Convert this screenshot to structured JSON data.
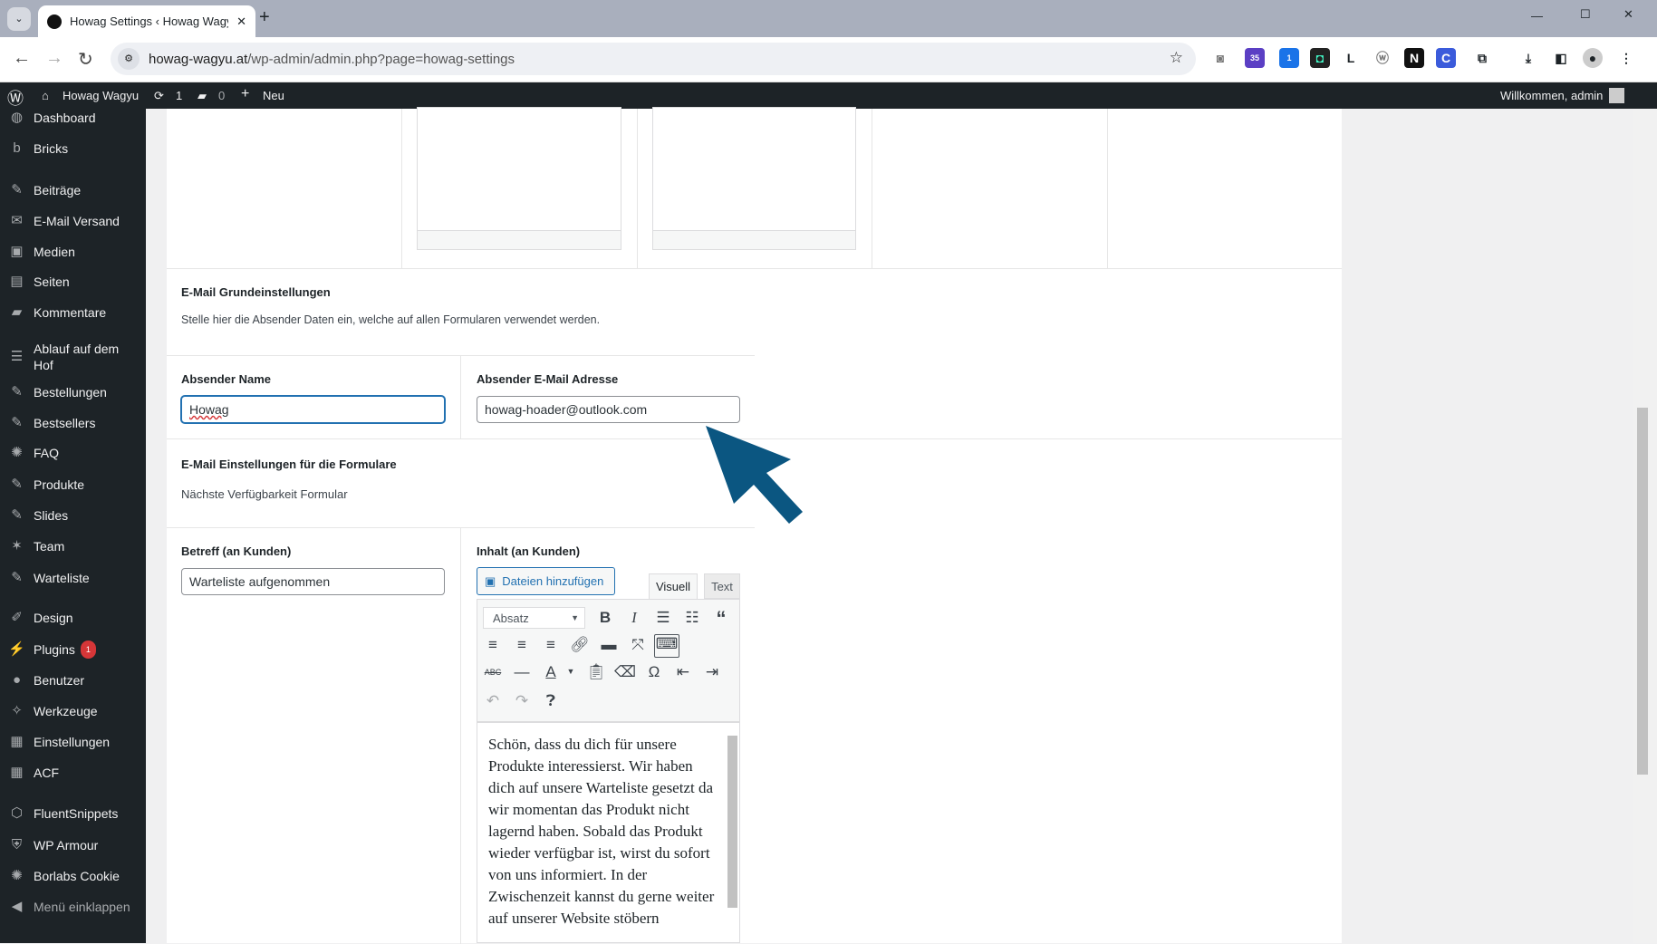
{
  "browser": {
    "tab_title": "Howag Settings ‹ Howag Wagyu",
    "url_host": "howag-wagyu.at",
    "url_path": "/wp-admin/admin.php?page=howag-settings",
    "ext_badge": "35",
    "ext_badge2": "1"
  },
  "adminbar": {
    "site": "Howag Wagyu",
    "updates": "1",
    "comments": "0",
    "new": "Neu",
    "welcome": "Willkommen, admin"
  },
  "sidebar": {
    "items": [
      {
        "label": "Dashboard",
        "icon": "◍"
      },
      {
        "label": "Bricks",
        "icon": "b"
      },
      {
        "label": "Beiträge",
        "icon": "✎"
      },
      {
        "label": "E-Mail Versand",
        "icon": "✉"
      },
      {
        "label": "Medien",
        "icon": "▣"
      },
      {
        "label": "Seiten",
        "icon": "▤"
      },
      {
        "label": "Kommentare",
        "icon": "▰"
      },
      {
        "label": "Ablauf auf dem Hof",
        "icon": "☰"
      },
      {
        "label": "Bestellungen",
        "icon": "✎"
      },
      {
        "label": "Bestsellers",
        "icon": "✎"
      },
      {
        "label": "FAQ",
        "icon": "✺"
      },
      {
        "label": "Produkte",
        "icon": "✎"
      },
      {
        "label": "Slides",
        "icon": "✎"
      },
      {
        "label": "Team",
        "icon": "✶"
      },
      {
        "label": "Warteliste",
        "icon": "✎"
      },
      {
        "label": "Design",
        "icon": "✐"
      },
      {
        "label": "Plugins",
        "icon": "⚡",
        "badge": "1"
      },
      {
        "label": "Benutzer",
        "icon": "●"
      },
      {
        "label": "Werkzeuge",
        "icon": "✧"
      },
      {
        "label": "Einstellungen",
        "icon": "▦"
      },
      {
        "label": "ACF",
        "icon": "▦"
      },
      {
        "label": "FluentSnippets",
        "icon": "⬡"
      },
      {
        "label": "WP Armour",
        "icon": "⛨"
      },
      {
        "label": "Borlabs Cookie",
        "icon": "✺"
      },
      {
        "label": "Menü einklappen",
        "icon": "◀"
      }
    ]
  },
  "section1": {
    "title": "E-Mail Grundeinstellungen",
    "desc": "Stelle hier die Absender Daten ein, welche auf allen Formularen verwendet werden."
  },
  "sender": {
    "name_label": "Absender Name",
    "name_value": "Howag",
    "email_label": "Absender E-Mail Adresse",
    "email_value": "howag-hoader@outlook.com"
  },
  "section2": {
    "title": "E-Mail Einstellungen für die Formulare",
    "subtitle": "Nächste Verfügbarkeit Formular"
  },
  "form": {
    "subject_label": "Betreff (an Kunden)",
    "subject_value": "Warteliste aufgenommen",
    "content_label": "Inhalt (an Kunden)",
    "add_media": "Dateien hinzufügen",
    "tab_visual": "Visuell",
    "tab_text": "Text",
    "format": "Absatz",
    "content": "Schön, dass du dich für unsere Produkte interessierst. Wir haben dich auf unsere Warteliste gesetzt da wir momentan das Produkt nicht lagernd haben. Sobald das Produkt wieder verfügbar ist, wirst du sofort von uns informiert. In der Zwischenzeit kannst du gerne weiter auf unserer Website stöbern"
  },
  "colors": {
    "arrow": "#0b5681",
    "admin_bar": "#1d2327",
    "link": "#2271b1"
  }
}
